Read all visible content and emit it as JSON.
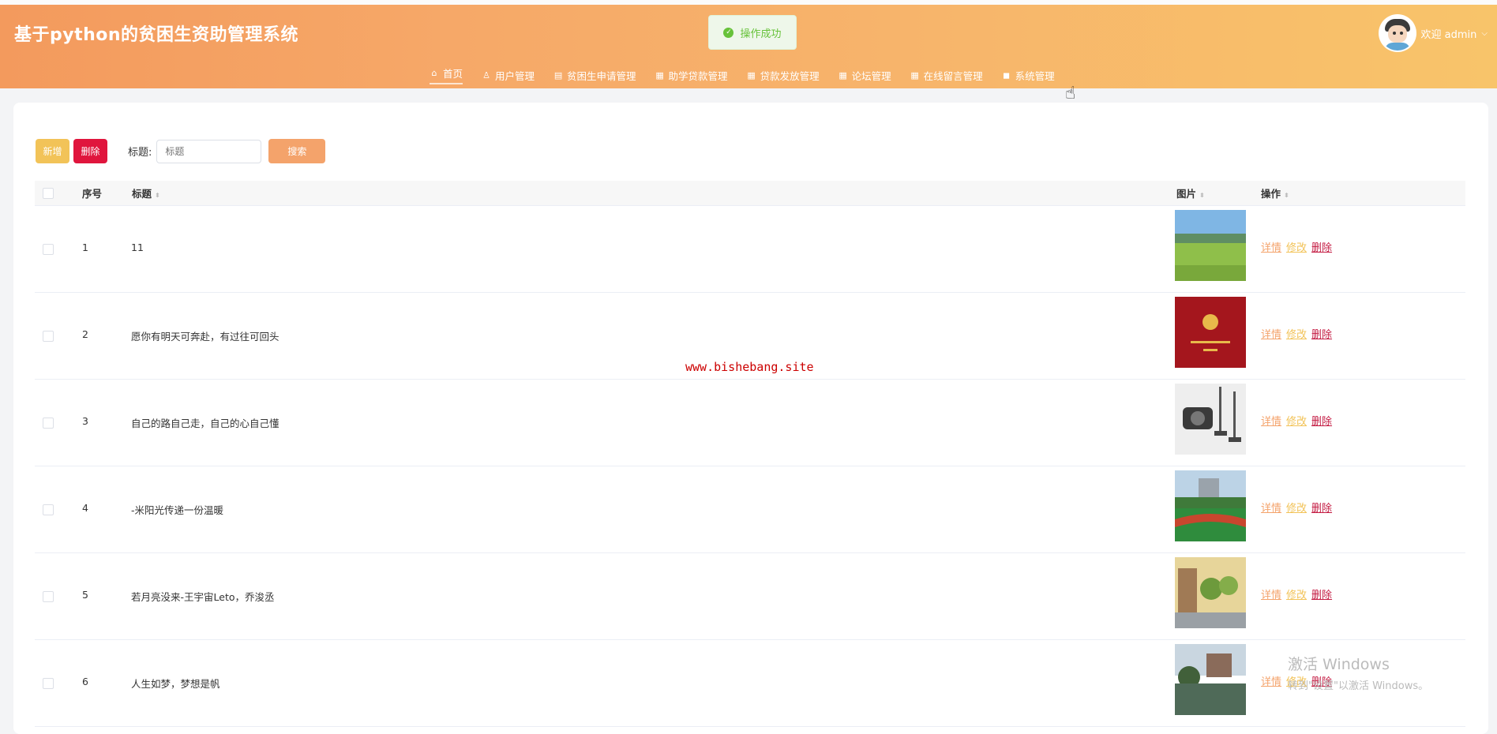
{
  "header": {
    "title": "基于python的贫困生资助管理系统",
    "toast": "操作成功",
    "welcome": "欢迎 admin",
    "nav": [
      {
        "icon": "home-icon",
        "glyph": "⌂",
        "label": "首页"
      },
      {
        "icon": "user-icon",
        "glyph": "♙",
        "label": "用户管理"
      },
      {
        "icon": "form-icon",
        "glyph": "▤",
        "label": "贫困生申请管理"
      },
      {
        "icon": "form-icon",
        "glyph": "▦",
        "label": "助学贷款管理"
      },
      {
        "icon": "form-icon",
        "glyph": "▦",
        "label": "贷款发放管理"
      },
      {
        "icon": "form-icon",
        "glyph": "▦",
        "label": "论坛管理"
      },
      {
        "icon": "form-icon",
        "glyph": "▦",
        "label": "在线留言管理"
      },
      {
        "icon": "bookmark-icon",
        "glyph": "◼",
        "label": "系统管理"
      }
    ]
  },
  "toolbar": {
    "add_label": "新增",
    "delete_label": "删除",
    "search_label": "标题:",
    "search_placeholder": "标题",
    "search_button": "搜索"
  },
  "table": {
    "headers": {
      "index": "序号",
      "title": "标题",
      "image": "图片",
      "actions": "操作"
    },
    "actions": {
      "detail": "详情",
      "edit": "修改",
      "delete": "删除"
    },
    "rows": [
      {
        "index": "1",
        "title": "11"
      },
      {
        "index": "2",
        "title": "愿你有明天可奔赴，有过往可回头"
      },
      {
        "index": "3",
        "title": "自己的路自己走，自己的心自己懂"
      },
      {
        "index": "4",
        "title": "-米阳光传递一份温暖"
      },
      {
        "index": "5",
        "title": "若月亮没来-王宇宙Leto，乔浚丞"
      },
      {
        "index": "6",
        "title": "人生如梦，梦想是帆"
      }
    ]
  },
  "overlay": {
    "watermark": "www.bishebang.site",
    "activate_title": "激活 Windows",
    "activate_sub": "转到\"设置\"以激活 Windows。"
  }
}
